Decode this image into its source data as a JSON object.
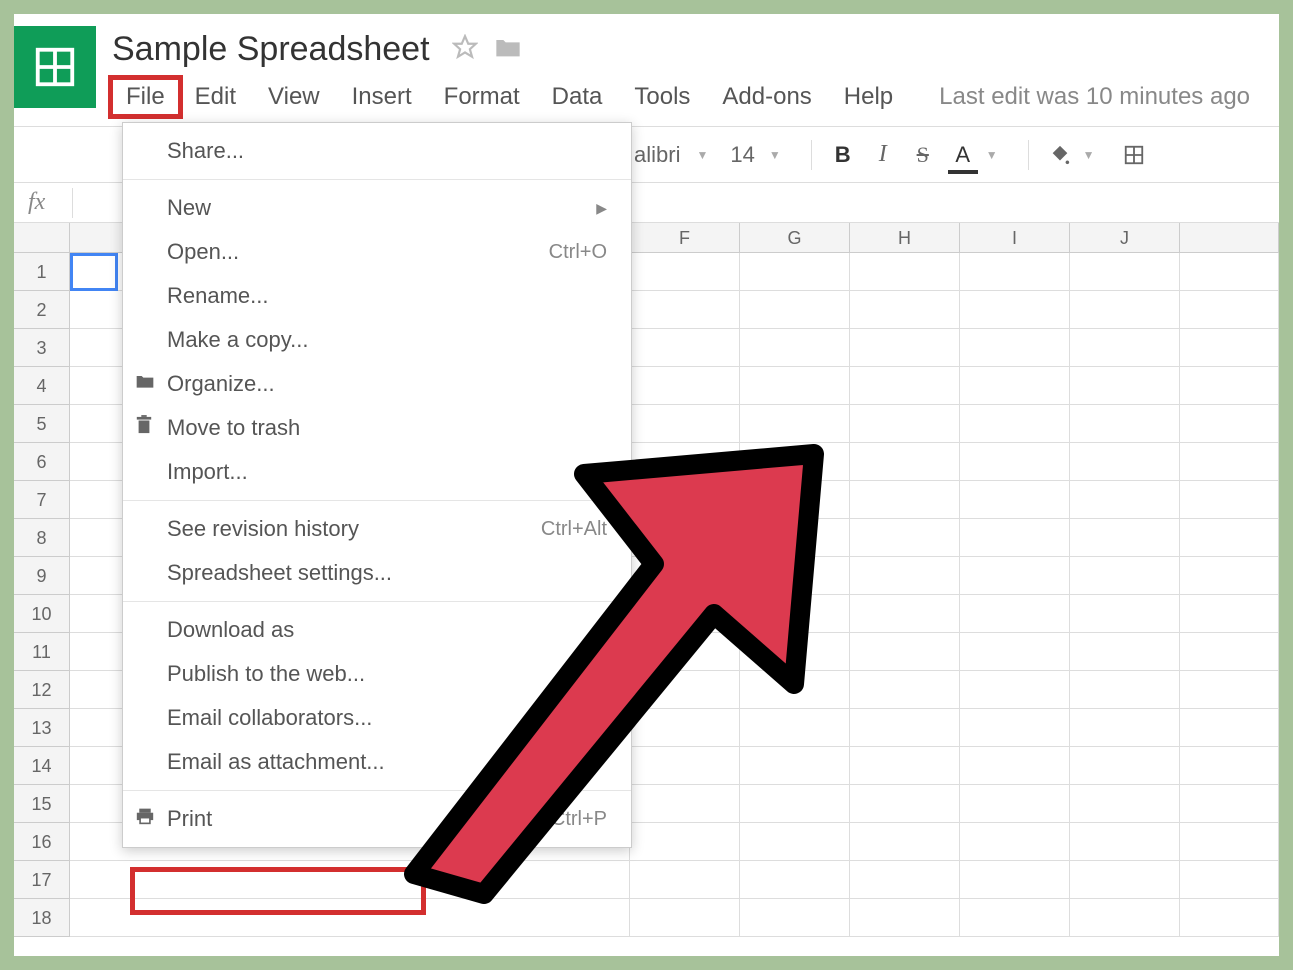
{
  "doc": {
    "title": "Sample Spreadsheet"
  },
  "menubar": {
    "file": "File",
    "edit": "Edit",
    "view": "View",
    "insert": "Insert",
    "format": "Format",
    "data": "Data",
    "tools": "Tools",
    "addons": "Add-ons",
    "help": "Help",
    "last_edit": "Last edit was 10 minutes ago"
  },
  "toolbar": {
    "font_name": "alibri",
    "font_size": "14",
    "bold": "B",
    "italic": "I",
    "strike": "S",
    "textcolor": "A"
  },
  "formula": {
    "fx": "fx"
  },
  "columns": [
    "F",
    "G",
    "H",
    "I",
    "J"
  ],
  "rows": [
    "1",
    "2",
    "3",
    "4",
    "5",
    "6",
    "7",
    "8",
    "9",
    "10",
    "11",
    "12",
    "13",
    "14",
    "15",
    "16",
    "17",
    "18"
  ],
  "file_menu": {
    "share": "Share...",
    "new": "New",
    "open": "Open...",
    "open_shortcut": "Ctrl+O",
    "rename": "Rename...",
    "make_copy": "Make a copy...",
    "organize": "Organize...",
    "move_to_trash": "Move to trash",
    "import": "Import...",
    "revision_history": "See revision history",
    "revision_shortcut": "Ctrl+Alt",
    "spreadsheet_settings": "Spreadsheet settings...",
    "download_as": "Download as",
    "publish_web": "Publish to the web...",
    "email_collab": "Email collaborators...",
    "email_attachment": "Email as attachment...",
    "print": "Print",
    "print_shortcut": "Ctrl+P"
  }
}
